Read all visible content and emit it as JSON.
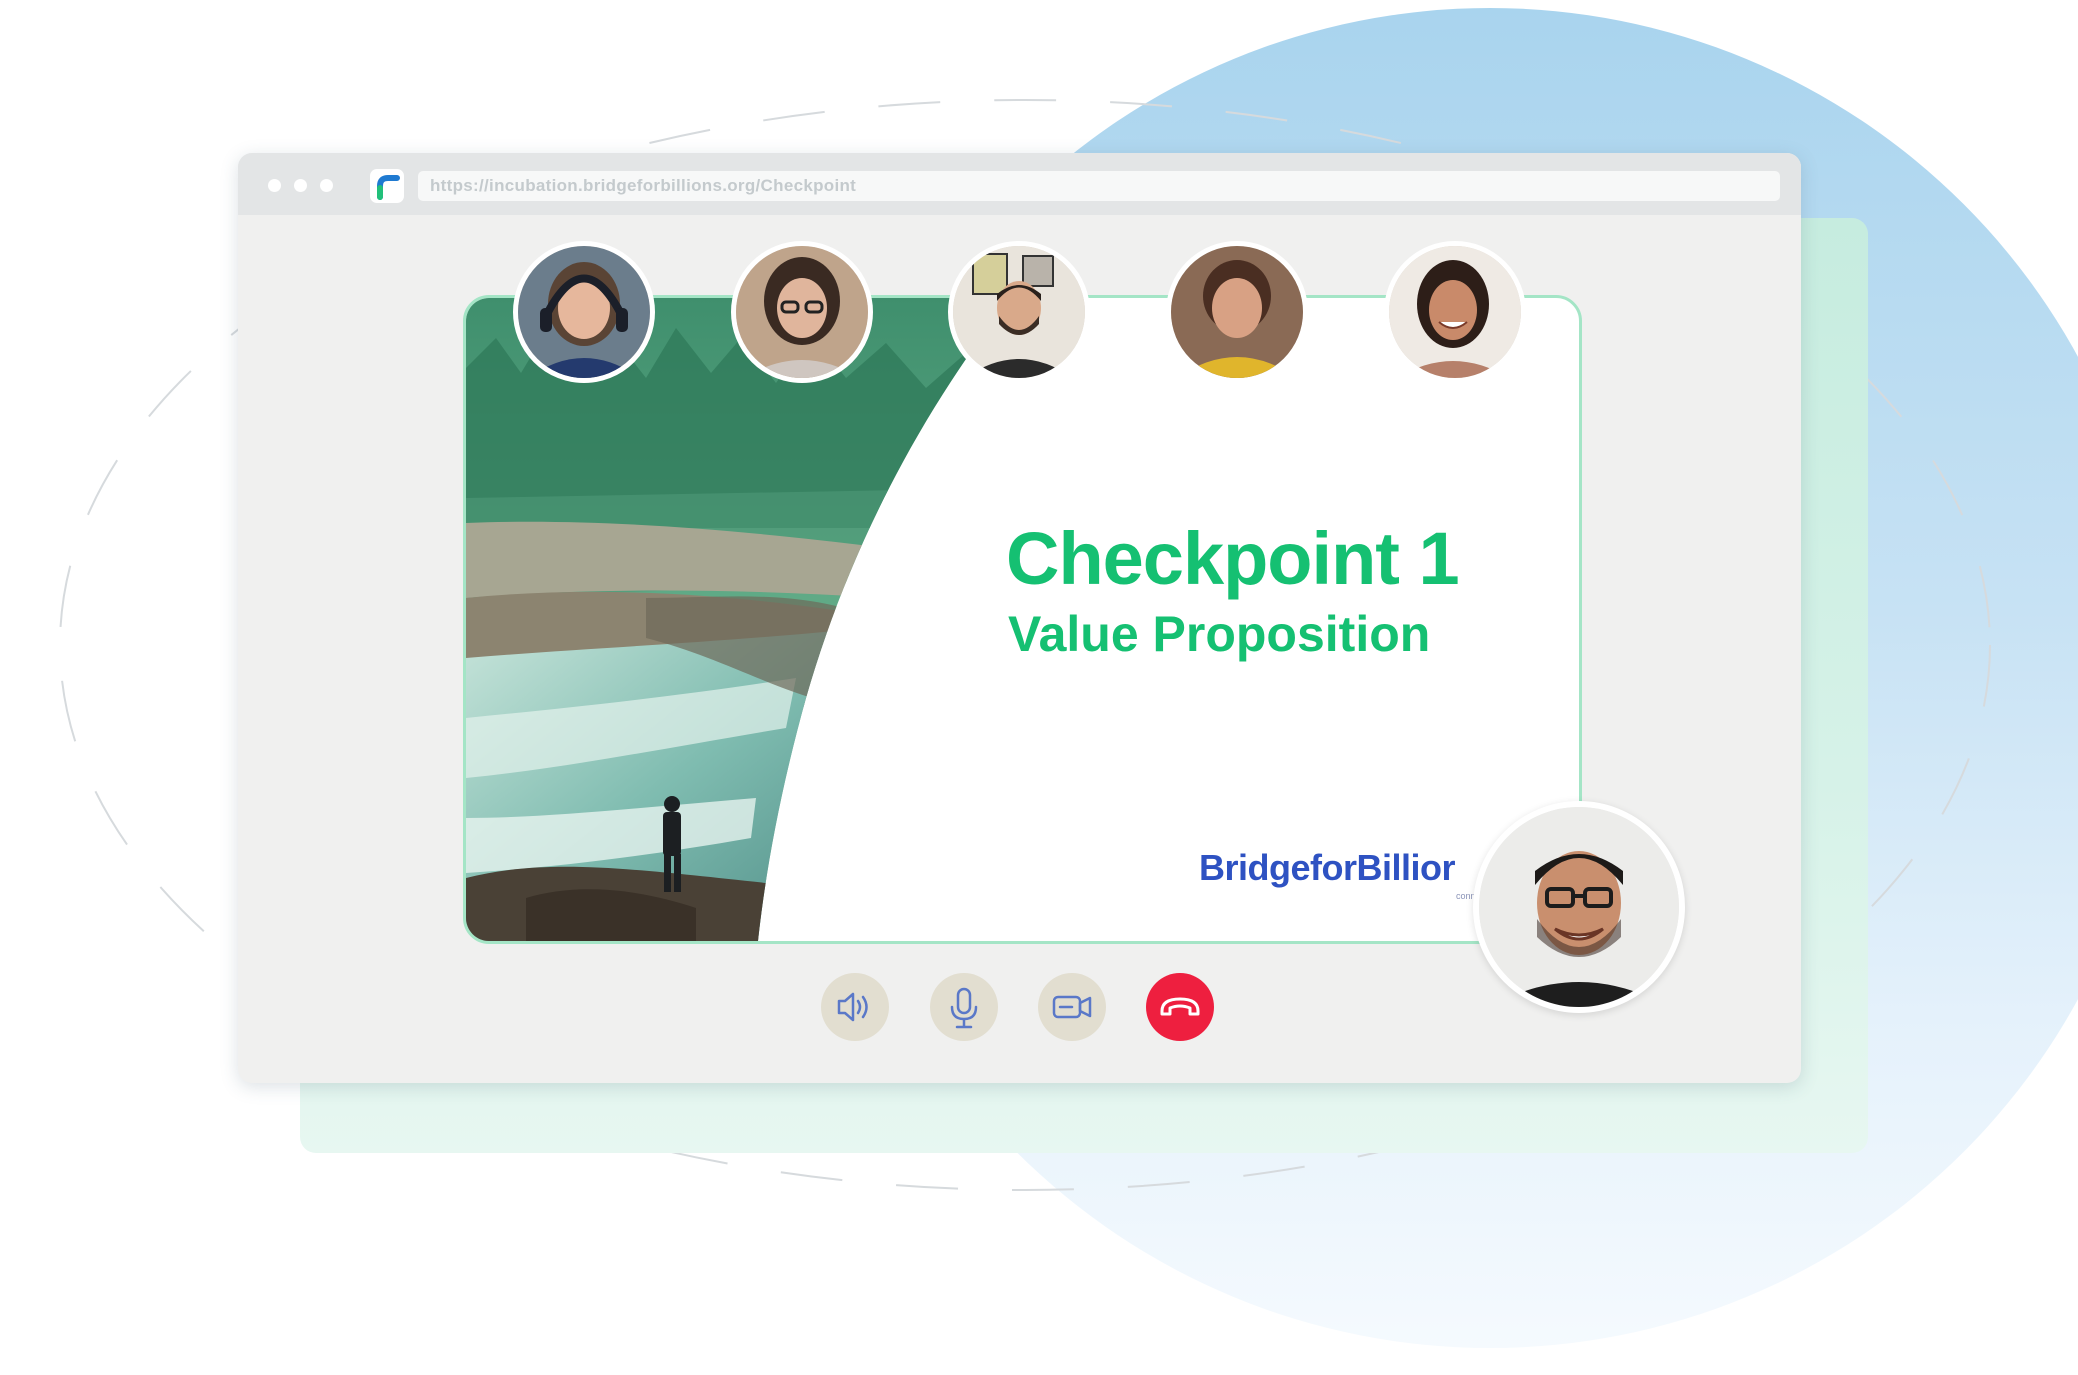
{
  "browser": {
    "url": "https://incubation.bridgeforbillions.org/Checkpoint"
  },
  "slide": {
    "title": "Checkpoint 1",
    "subtitle": "Value Proposition",
    "brand_name": "BridgeforBillior",
    "brand_tagline": "connecting gr"
  },
  "participants": [
    {
      "icon": "participant-1-video"
    },
    {
      "icon": "participant-2-video"
    },
    {
      "icon": "participant-3-video"
    },
    {
      "icon": "participant-4-video"
    },
    {
      "icon": "participant-5-video"
    },
    {
      "icon": "presenter-video"
    }
  ],
  "controls": [
    {
      "icon": "speaker-icon"
    },
    {
      "icon": "microphone-icon"
    },
    {
      "icon": "camera-icon"
    },
    {
      "icon": "end-call-icon"
    }
  ],
  "colors": {
    "brand_green": "#15c072",
    "brand_blue": "#2e52c2",
    "end_call_red": "#ee1f3f",
    "control_bg": "#e2ded0"
  }
}
